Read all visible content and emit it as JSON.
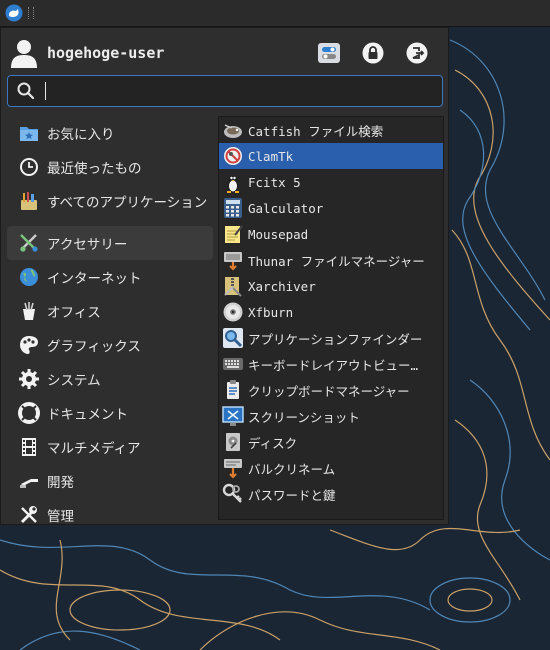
{
  "user": {
    "name": "hogehoge-user"
  },
  "search": {
    "value": "",
    "placeholder": ""
  },
  "categories": [
    {
      "label": "お気に入り",
      "icon": "favorites-folder-icon"
    },
    {
      "label": "最近使ったもの",
      "icon": "clock-icon"
    },
    {
      "label": "すべてのアプリケーション",
      "icon": "all-applications-icon"
    },
    {
      "label": "アクセサリー",
      "icon": "accessories-icon",
      "active": true
    },
    {
      "label": "インターネット",
      "icon": "globe-icon"
    },
    {
      "label": "オフィス",
      "icon": "office-icon"
    },
    {
      "label": "グラフィックス",
      "icon": "graphics-palette-icon"
    },
    {
      "label": "システム",
      "icon": "gear-icon"
    },
    {
      "label": "ドキュメント",
      "icon": "help-lifebuoy-icon"
    },
    {
      "label": "マルチメディア",
      "icon": "film-strip-icon"
    },
    {
      "label": "開発",
      "icon": "development-icon"
    },
    {
      "label": "管理",
      "icon": "admin-tools-icon"
    }
  ],
  "apps": [
    {
      "label": "Catfish ファイル検索",
      "icon": "catfish-icon"
    },
    {
      "label": "ClamTk",
      "icon": "clamtk-icon",
      "selected": true
    },
    {
      "label": "Fcitx 5",
      "icon": "penguin-icon"
    },
    {
      "label": "Galculator",
      "icon": "calculator-icon"
    },
    {
      "label": "Mousepad",
      "icon": "notepad-icon"
    },
    {
      "label": "Thunar ファイルマネージャー",
      "icon": "file-manager-icon"
    },
    {
      "label": "Xarchiver",
      "icon": "archive-icon"
    },
    {
      "label": "Xfburn",
      "icon": "disc-icon"
    },
    {
      "label": "アプリケーションファインダー",
      "icon": "magnifier-icon"
    },
    {
      "label": "キーボードレイアウトビュー…",
      "icon": "keyboard-icon"
    },
    {
      "label": "クリップボードマネージャー",
      "icon": "clipboard-icon"
    },
    {
      "label": "スクリーンショット",
      "icon": "screenshot-icon"
    },
    {
      "label": "ディスク",
      "icon": "disk-drive-icon"
    },
    {
      "label": "バルクリネーム",
      "icon": "bulk-rename-icon"
    },
    {
      "label": "パスワードと鍵",
      "icon": "keys-icon"
    }
  ],
  "colors": {
    "selection": "#2a5fad",
    "search_border": "#3a78c2",
    "menu_bg": "#2e2e2e",
    "desktop_bg": "#1b2634"
  }
}
